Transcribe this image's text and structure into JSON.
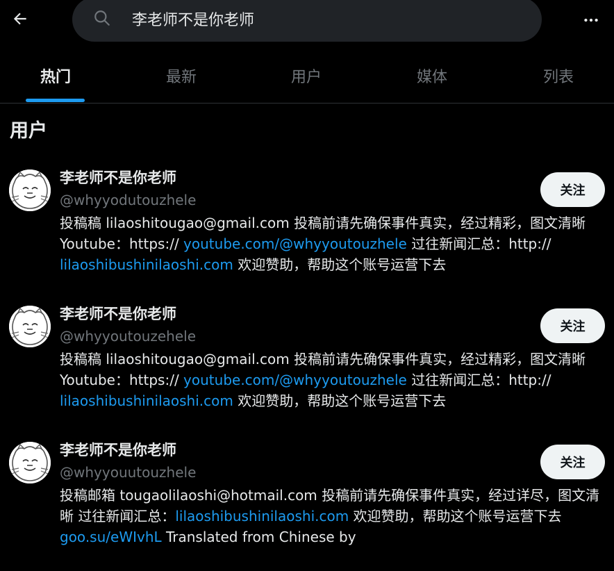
{
  "search": {
    "query": "李老师不是你老师"
  },
  "icons": {
    "back": "arrow-left-icon",
    "search": "search-icon",
    "more": "more-horizontal-icon"
  },
  "tabs": [
    {
      "label": "热门",
      "active": true
    },
    {
      "label": "最新",
      "active": false
    },
    {
      "label": "用户",
      "active": false
    },
    {
      "label": "媒体",
      "active": false
    },
    {
      "label": "列表",
      "active": false
    }
  ],
  "section": {
    "title": "用户"
  },
  "users": [
    {
      "name": "李老师不是你老师",
      "handle": "@whyyodutouzhele",
      "follow_label": "关注",
      "bio": [
        {
          "text": "投稿稿 lilaoshitougao@gmail.com 投稿前请先确保事件真实，经过精彩，图文清晰 Youtube：https:// "
        },
        {
          "text": "youtube.com/@whyyoutouzhele",
          "link": true
        },
        {
          "text": " 过往新闻汇总：http:// "
        },
        {
          "text": "lilaoshibushinilaoshi.com",
          "link": true
        },
        {
          "text": " 欢迎赞助，帮助这个账号运营下去"
        }
      ]
    },
    {
      "name": "李老师不是你老师",
      "handle": "@whyyoutouzehele",
      "follow_label": "关注",
      "bio": [
        {
          "text": "投稿稿 lilaoshitougao@gmail.com 投稿前请先确保事件真实，经过精彩，图文清晰 Youtube：https:// "
        },
        {
          "text": "youtube.com/@whyyoutouzhele",
          "link": true
        },
        {
          "text": " 过往新闻汇总：http:// "
        },
        {
          "text": "lilaoshibushinilaoshi.com",
          "link": true
        },
        {
          "text": " 欢迎赞助，帮助这个账号运营下去"
        }
      ]
    },
    {
      "name": "李老师不是你老师",
      "handle": "@whyyouutouzhele",
      "follow_label": "关注",
      "bio": [
        {
          "text": "投稿邮箱 tougaolilaoshi@hotmail.com 投稿前请先确保事件真实，经过详尽，图文清晰 过往新闻汇总："
        },
        {
          "text": "lilaoshibushinilaoshi.com",
          "link": true
        },
        {
          "text": " 欢迎赞助，帮助这个账号运营下去"
        },
        {
          "text": "goo.su/eWIvhL",
          "link": true
        },
        {
          "text": " Translated from Chinese by"
        }
      ]
    }
  ],
  "colors": {
    "accent": "#1d9bf0",
    "background": "#000000",
    "muted": "#71767b",
    "text": "#e7e9ea"
  }
}
